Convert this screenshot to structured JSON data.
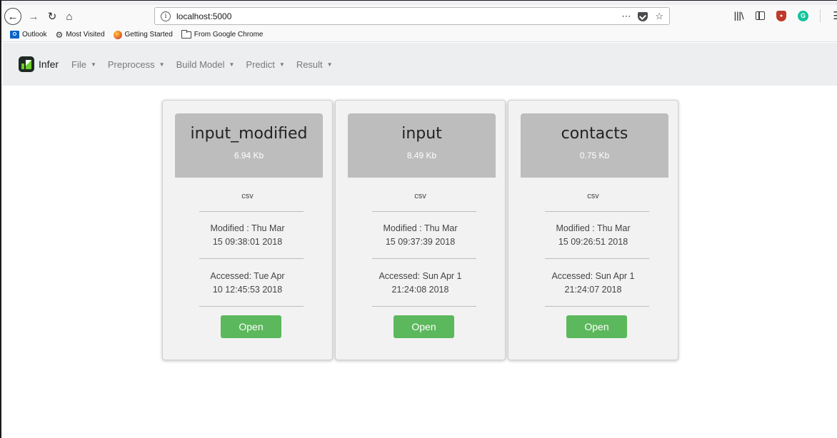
{
  "browser": {
    "url": "localhost:5000",
    "icons": {
      "back": "back-arrow-icon",
      "forward": "forward-arrow-icon",
      "reload": "reload-icon",
      "home": "home-icon"
    }
  },
  "bookmarks": [
    {
      "label": "Outlook",
      "icon": "outlook-icon"
    },
    {
      "label": "Most Visited",
      "icon": "gear-icon"
    },
    {
      "label": "Getting Started",
      "icon": "firefox-icon"
    },
    {
      "label": "From Google Chrome",
      "icon": "folder-icon"
    }
  ],
  "app": {
    "brand": "Infer",
    "menu": [
      {
        "label": "File"
      },
      {
        "label": "Preprocess"
      },
      {
        "label": "Build Model"
      },
      {
        "label": "Predict"
      },
      {
        "label": "Result"
      }
    ],
    "accent_color": "#5cb85c"
  },
  "files": [
    {
      "name": "input_modified",
      "size": "6.94 Kb",
      "type": "csv",
      "modified_1": "Modified : Thu Mar",
      "modified_2": "15 09:38:01 2018",
      "accessed_1": "Accessed: Tue Apr",
      "accessed_2": "10 12:45:53 2018",
      "action": "Open"
    },
    {
      "name": "input",
      "size": "8.49 Kb",
      "type": "csv",
      "modified_1": "Modified : Thu Mar",
      "modified_2": "15 09:37:39 2018",
      "accessed_1": "Accessed: Sun Apr 1",
      "accessed_2": "21:24:08 2018",
      "action": "Open"
    },
    {
      "name": "contacts",
      "size": "0.75 Kb",
      "type": "csv",
      "modified_1": "Modified : Thu Mar",
      "modified_2": "15 09:26:51 2018",
      "accessed_1": "Accessed: Sun Apr 1",
      "accessed_2": "21:24:07 2018",
      "action": "Open"
    }
  ]
}
